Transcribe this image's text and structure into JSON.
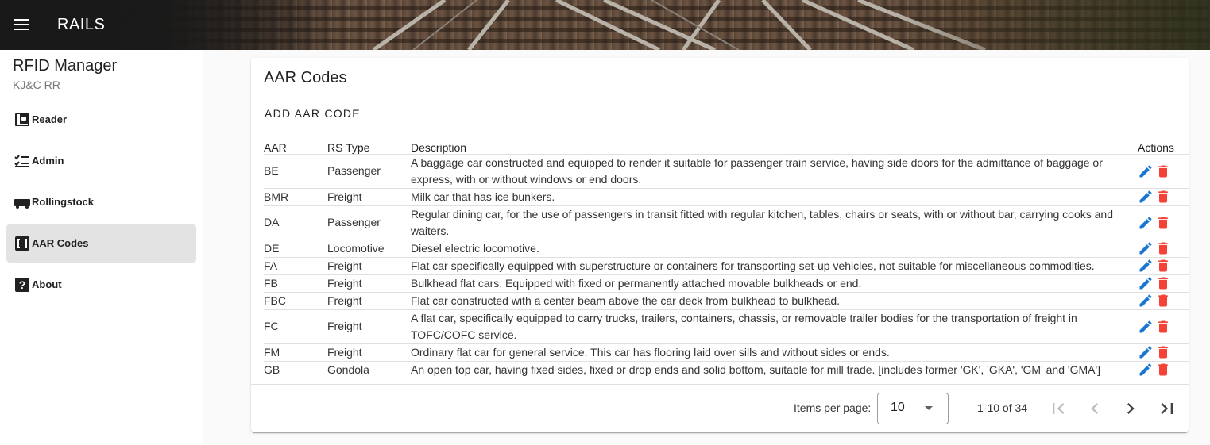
{
  "app": {
    "title": "RAILS"
  },
  "sidebar": {
    "title": "RFID Manager",
    "subtitle": "KJ&C RR",
    "items": [
      {
        "label": "Reader",
        "icon": "contactless-icon"
      },
      {
        "label": "Admin",
        "icon": "checklist-icon"
      },
      {
        "label": "Rollingstock",
        "icon": "train-car-icon"
      },
      {
        "label": "AAR Codes",
        "icon": "data-array-icon",
        "active": true
      },
      {
        "label": "About",
        "icon": "help-icon"
      }
    ]
  },
  "main": {
    "title": "AAR Codes",
    "add_label": "ADD AAR CODE",
    "columns": [
      "AAR",
      "RS Type",
      "Description",
      "Actions"
    ],
    "rows": [
      {
        "aar": "BE",
        "type": "Passenger",
        "desc": "A baggage car constructed and equipped to render it suitable for passenger train service, having side doors for the admittance of baggage or express, with or without windows or end doors."
      },
      {
        "aar": "BMR",
        "type": "Freight",
        "desc": "Milk car that has ice bunkers."
      },
      {
        "aar": "DA",
        "type": "Passenger",
        "desc": "Regular dining car, for the use of passengers in transit fitted with regular kitchen, tables, chairs or seats, with or without bar, carrying cooks and waiters."
      },
      {
        "aar": "DE",
        "type": "Locomotive",
        "desc": "Diesel electric locomotive."
      },
      {
        "aar": "FA",
        "type": "Freight",
        "desc": "Flat car specifically equipped with superstructure or containers for transporting set-up vehicles, not suitable for miscellaneous commodities."
      },
      {
        "aar": "FB",
        "type": "Freight",
        "desc": "Bulkhead flat cars. Equipped with fixed or permanently attached movable bulkheads or end."
      },
      {
        "aar": "FBC",
        "type": "Freight",
        "desc": "Flat car constructed with a center beam above the car deck from bulkhead to bulkhead."
      },
      {
        "aar": "FC",
        "type": "Freight",
        "desc": "A flat car, specifically equipped to carry trucks, trailers, containers, chassis, or removable trailer bodies for the transportation of freight in TOFC/COFC service."
      },
      {
        "aar": "FM",
        "type": "Freight",
        "desc": "Ordinary flat car for general service. This car has flooring laid over sills and without sides or ends."
      },
      {
        "aar": "GB",
        "type": "Gondola",
        "desc": "An open top car, having fixed sides, fixed or drop ends and solid bottom, suitable for mill trade. [includes former 'GK', 'GKA', 'GM' and 'GMA']"
      }
    ]
  },
  "paginator": {
    "items_per_page_label": "Items per page:",
    "items_per_page": "10",
    "range": "1-10 of 34"
  },
  "colors": {
    "edit": "#1976d2",
    "delete": "#f44336",
    "active_nav": "#e3e3e3"
  }
}
